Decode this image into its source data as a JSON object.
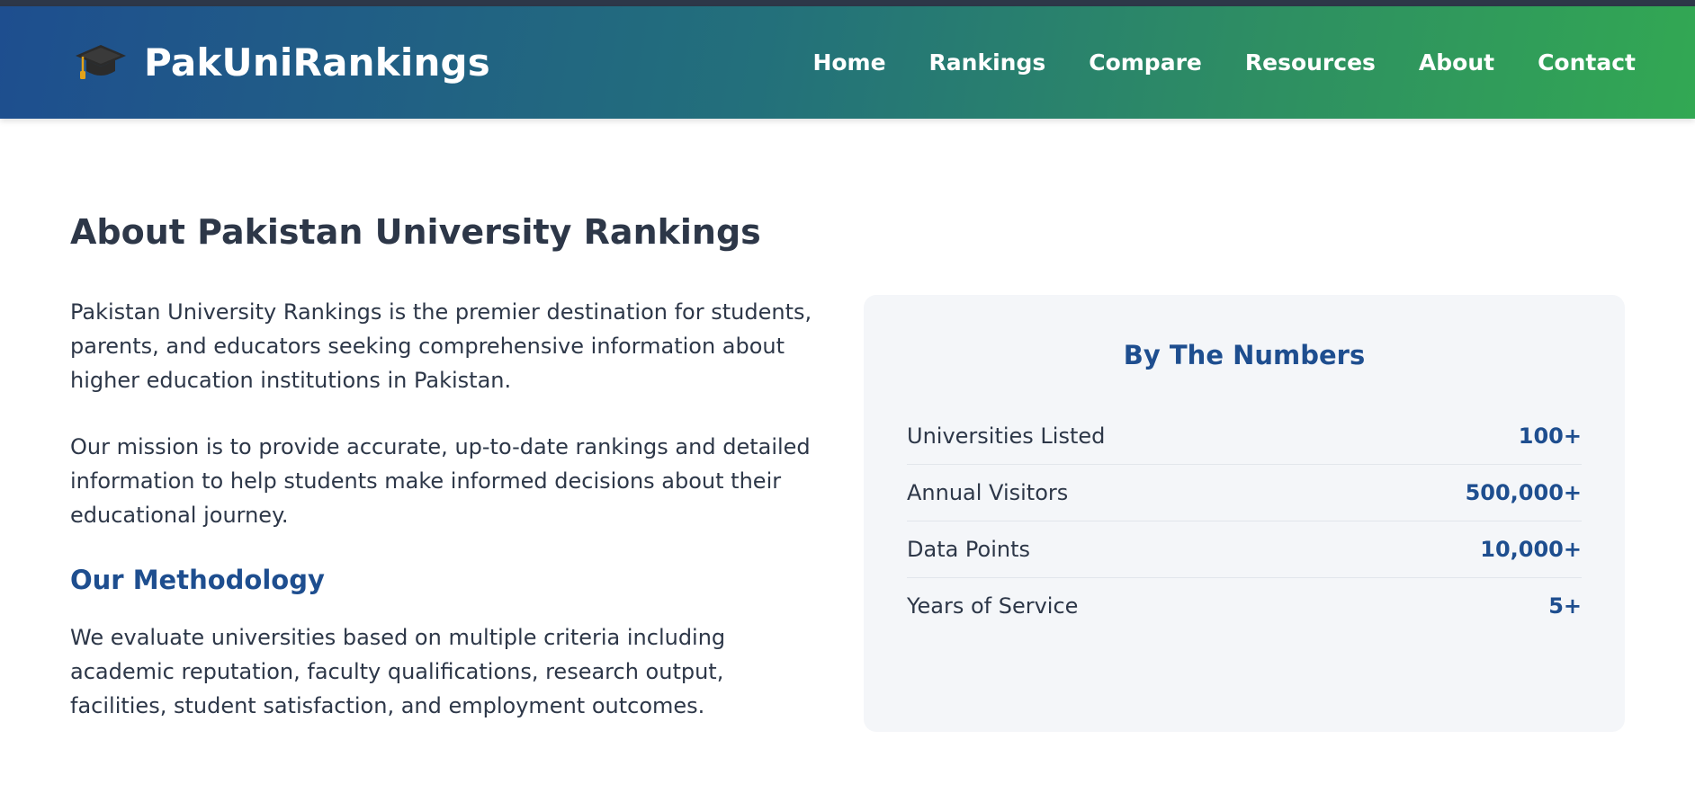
{
  "header": {
    "brand_name": "PakUniRankings",
    "brand_icon": "graduation-cap-icon",
    "nav": [
      {
        "label": "Home"
      },
      {
        "label": "Rankings"
      },
      {
        "label": "Compare"
      },
      {
        "label": "Resources"
      },
      {
        "label": "About"
      },
      {
        "label": "Contact"
      }
    ]
  },
  "main": {
    "title": "About Pakistan University Rankings",
    "paragraphs": [
      "Pakistan University Rankings is the premier destination for students, parents, and educators seeking comprehensive information about higher education institutions in Pakistan.",
      "Our mission is to provide accurate, up-to-date rankings and detailed information to help students make informed decisions about their educational journey."
    ],
    "methodology": {
      "title": "Our Methodology",
      "text": "We evaluate universities based on multiple criteria including academic reputation, faculty qualifications, research output, facilities, student satisfaction, and employment outcomes."
    },
    "stats": {
      "title": "By The Numbers",
      "rows": [
        {
          "label": "Universities Listed",
          "value": "100+"
        },
        {
          "label": "Annual Visitors",
          "value": "500,000+"
        },
        {
          "label": "Data Points",
          "value": "10,000+"
        },
        {
          "label": "Years of Service",
          "value": "5+"
        }
      ]
    }
  },
  "colors": {
    "accent_blue": "#1e4e8f",
    "accent_green": "#32a853",
    "text_dark": "#2d3748",
    "card_bg": "#f4f6f9"
  }
}
